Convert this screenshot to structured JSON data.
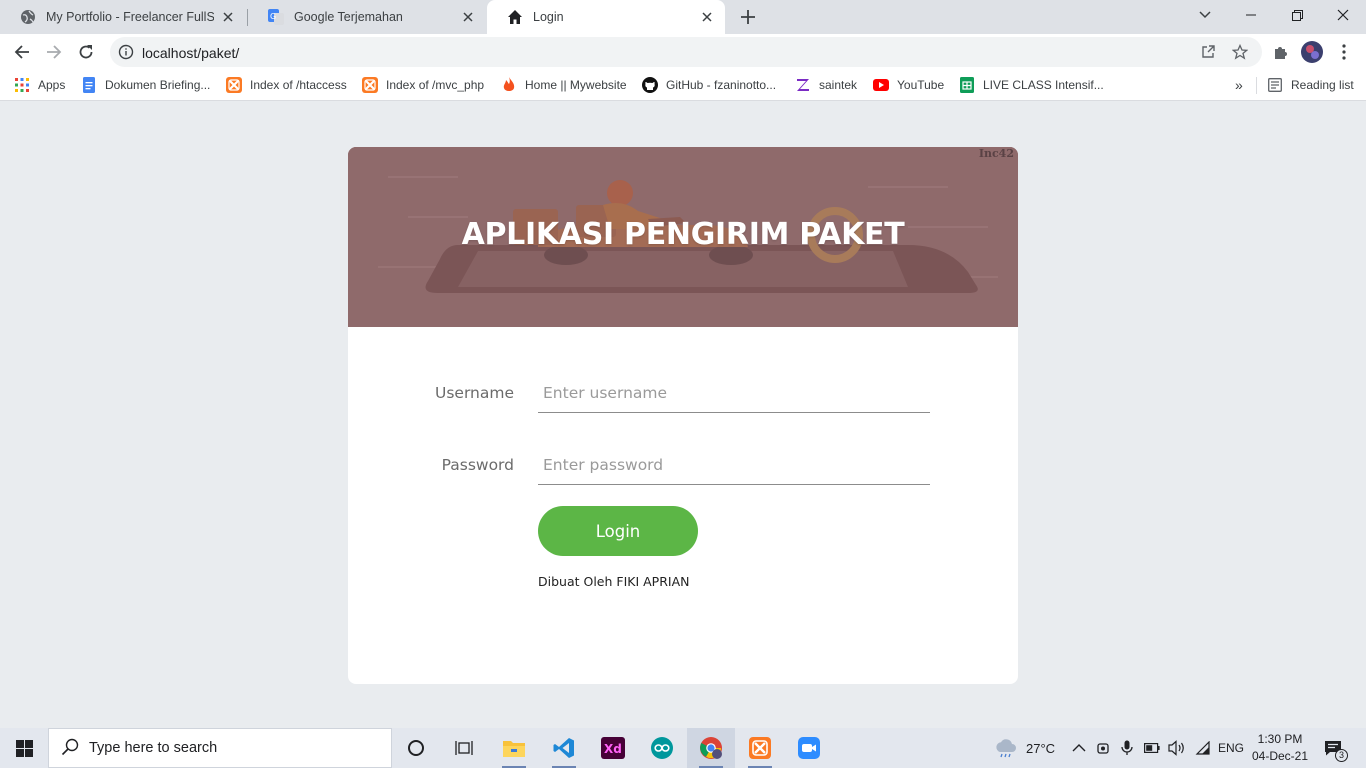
{
  "browser": {
    "tabs": [
      {
        "title": "My Portfolio - Freelancer FullStac",
        "favicon": "globe-icon"
      },
      {
        "title": "Google Terjemahan",
        "favicon": "google-translate-icon"
      },
      {
        "title": "Login",
        "favicon": "home-icon"
      }
    ],
    "url": "localhost/paket/",
    "bookmarks": [
      {
        "label": "Apps",
        "icon": "apps-grid-icon"
      },
      {
        "label": "Dokumen Briefing...",
        "icon": "google-docs-icon"
      },
      {
        "label": "Index of /htaccess",
        "icon": "xampp-icon"
      },
      {
        "label": "Index of /mvc_php",
        "icon": "xampp-icon"
      },
      {
        "label": "Home || Mywebsite",
        "icon": "fire-icon"
      },
      {
        "label": "GitHub - fzaninotto...",
        "icon": "github-icon"
      },
      {
        "label": "saintek",
        "icon": "zenius-icon"
      },
      {
        "label": "YouTube",
        "icon": "youtube-icon"
      },
      {
        "label": "LIVE CLASS Intensif...",
        "icon": "sheets-icon"
      }
    ],
    "overflow": "»",
    "reading_list": "Reading list"
  },
  "page": {
    "hero_title": "APLIKASI PENGIRIM PAKET",
    "hero_brand": "Inc42",
    "username": {
      "label": "Username",
      "placeholder": "Enter username",
      "value": ""
    },
    "password": {
      "label": "Password",
      "placeholder": "Enter password",
      "value": ""
    },
    "login_button": "Login",
    "credit": "Dibuat Oleh FIKI APRIAN"
  },
  "taskbar": {
    "search_placeholder": "Type here to search",
    "weather": "27°C",
    "language": "ENG",
    "time": "1:30 PM",
    "date": "04-Dec-21",
    "notification_count": "3"
  },
  "colors": {
    "login_button": "#5cb646",
    "hero_overlay": "#8f6a6b",
    "page_background": "#e9ecef"
  }
}
